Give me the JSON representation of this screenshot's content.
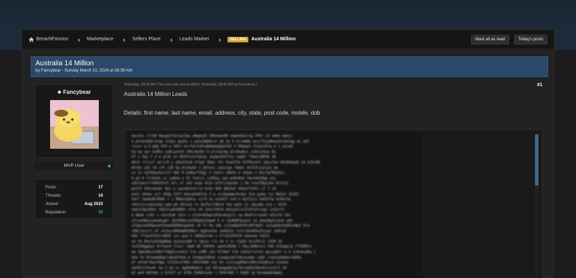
{
  "breadcrumb": {
    "items": [
      "BreachForums",
      "Marketplace",
      "Sellers Place",
      "Leads Market"
    ],
    "badge": "SELLING",
    "current": "Australia 14 Million"
  },
  "toolbar": {
    "mark_read_label": "Mark all as read",
    "todays_posts_label": "Today's posts"
  },
  "thread": {
    "title": "Australia 14 Million",
    "byline": "by Fancybear - Sunday March 10, 2024 at 08:39 AM"
  },
  "author": {
    "name": "Fancybear",
    "usergroup": "MVP User",
    "stats": [
      {
        "label": "Posts:",
        "value": "17"
      },
      {
        "label": "Threads:",
        "value": "14"
      },
      {
        "label": "Joined:",
        "value": "Aug 2023"
      },
      {
        "label": "Reputation:",
        "value": "20"
      }
    ]
  },
  "post": {
    "meta": "Yesterday, 08:39 AM   (This post was last modified: Yesterday, 08:42 AM by Fancybear.)",
    "number": "#1",
    "line1": "Australia 14 Million Leads",
    "line2": "Details: first name, last name, email, address, city, state, post code, mobile, dob"
  },
  "colors": {
    "header_blue": "#2a4867",
    "selling_badge": "#d6a235",
    "reputation_green": "#3bb54a",
    "scroll_thumb": "#3e6a94"
  }
}
